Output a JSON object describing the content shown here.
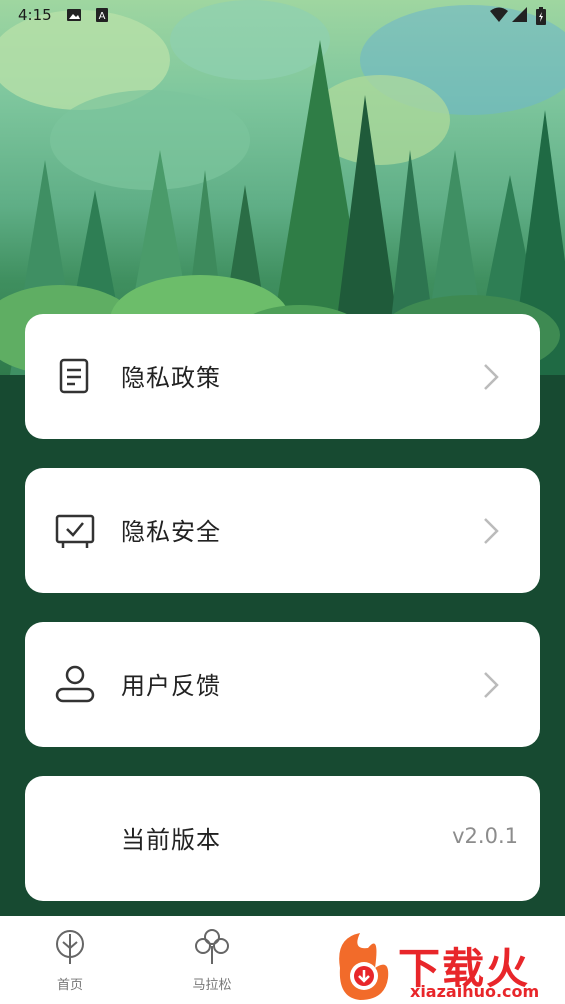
{
  "status_bar": {
    "time": "4:15"
  },
  "menu": [
    {
      "label": "隐私政策",
      "icon": "document-icon",
      "has_chevron": true
    },
    {
      "label": "隐私安全",
      "icon": "monitor-check-icon",
      "has_chevron": true
    },
    {
      "label": "用户反馈",
      "icon": "user-icon",
      "has_chevron": true
    },
    {
      "label": "当前版本",
      "value": "v2.0.1"
    }
  ],
  "tabs": [
    {
      "label": "首页",
      "icon": "tree-icon"
    },
    {
      "label": "马拉松",
      "icon": "clover-icon"
    }
  ],
  "watermark": {
    "text": "下载火",
    "url": "xiazaihuo.com"
  },
  "colors": {
    "background": "#174a31",
    "card": "#ffffff",
    "accent": "#e8262a"
  }
}
